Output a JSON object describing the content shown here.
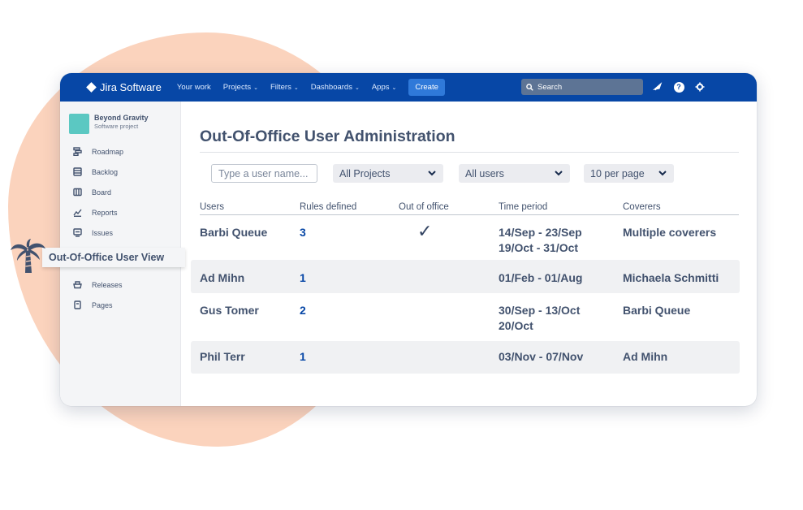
{
  "colors": {
    "nav_bg": "#0747a6",
    "accent_blob": "#fbd3bd",
    "link": "#0747a6",
    "project_avatar": "#5bc8c2"
  },
  "topbar": {
    "brand": "Jira Software",
    "nav": [
      {
        "label": "Your work",
        "chevron": false
      },
      {
        "label": "Projects",
        "chevron": true
      },
      {
        "label": "Filters",
        "chevron": true
      },
      {
        "label": "Dashboards",
        "chevron": true
      },
      {
        "label": "Apps",
        "chevron": true
      }
    ],
    "create_label": "Create",
    "search_placeholder": "Search",
    "icons": [
      "notification-icon",
      "help-icon",
      "settings-icon"
    ]
  },
  "sidebar": {
    "project_name": "Beyond Gravity",
    "project_type": "Software project",
    "items": [
      {
        "label": "Roadmap",
        "icon": "roadmap-icon"
      },
      {
        "label": "Backlog",
        "icon": "backlog-icon"
      },
      {
        "label": "Board",
        "icon": "board-icon"
      },
      {
        "label": "Reports",
        "icon": "reports-icon"
      },
      {
        "label": "Issues",
        "icon": "issues-icon"
      },
      {
        "label": "Releases",
        "icon": "releases-icon"
      },
      {
        "label": "Pages",
        "icon": "pages-icon"
      }
    ]
  },
  "callout": {
    "label": "Out-Of-Office User View",
    "icon": "palm-tree-icon"
  },
  "main": {
    "title": "Out-Of-Office User Administration",
    "filters": {
      "user_placeholder": "Type a user name...",
      "project_select": "All Projects",
      "users_select": "All users",
      "per_page_select": "10 per page"
    },
    "columns": [
      "Users",
      "Rules defined",
      "Out of office",
      "Time period",
      "Coverers"
    ],
    "rows": [
      {
        "user": "Barbi Queue",
        "rules": "3",
        "out_of_office": true,
        "period": [
          "14/Sep - 23/Sep",
          "19/Oct - 31/Oct"
        ],
        "coverers": "Multiple coverers"
      },
      {
        "user": "Ad Mihn",
        "rules": "1",
        "out_of_office": false,
        "period": [
          "01/Feb - 01/Aug"
        ],
        "coverers": "Michaela Schmitti"
      },
      {
        "user": "Gus Tomer",
        "rules": "2",
        "out_of_office": false,
        "period": [
          "30/Sep - 13/Oct",
          "20/Oct"
        ],
        "coverers": "Barbi Queue"
      },
      {
        "user": "Phil Terr",
        "rules": "1",
        "out_of_office": false,
        "period": [
          "03/Nov - 07/Nov"
        ],
        "coverers": "Ad Mihn"
      }
    ]
  }
}
